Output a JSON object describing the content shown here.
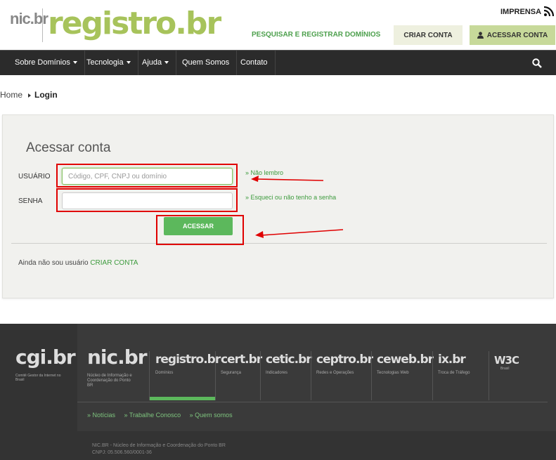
{
  "header": {
    "nic_logo": "nic.br",
    "registro_logo": "registro.br",
    "imprensa": "IMPRENSA",
    "search_register": "PESQUISAR E REGISTRAR DOMÍNIOS",
    "create_account": "CRIAR CONTA",
    "access_account": "ACESSAR CONTA"
  },
  "nav": {
    "items": [
      {
        "label": "Sobre Domínios",
        "dropdown": true
      },
      {
        "label": "Tecnologia",
        "dropdown": true
      },
      {
        "label": "Ajuda",
        "dropdown": true
      },
      {
        "label": "Quem Somos",
        "dropdown": false
      },
      {
        "label": "Contato",
        "dropdown": false
      }
    ]
  },
  "breadcrumb": {
    "home": "Home",
    "current": "Login"
  },
  "login": {
    "title": "Acessar conta",
    "user_label": "USUÁRIO",
    "user_placeholder": "Código, CPF, CNPJ ou domínio",
    "user_value": "",
    "forgot_user": "» Não lembro",
    "password_label": "SENHA",
    "password_value": "",
    "forgot_password": "» Esqueci ou não tenho a senha",
    "submit": "ACESSAR",
    "no_user_text": "Ainda não sou usuário",
    "create_account_link": "CRIAR CONTA"
  },
  "footer": {
    "cgi_logo": "cgi.br",
    "cgi_sub": "Comitê Gestor da Internet no Brasil",
    "nic_logo": "nic.br",
    "nic_sub": "Núcleo de Informação e Coordenação do Ponto BR",
    "sites": [
      {
        "logo": "registro.br",
        "sub": "Domínios"
      },
      {
        "logo": "cert.br",
        "sub": "Segurança"
      },
      {
        "logo": "cetic.br",
        "sub": "Indicadores"
      },
      {
        "logo": "ceptro.br",
        "sub": "Redes e Operações"
      },
      {
        "logo": "ceweb.br",
        "sub": "Tecnologias Web"
      },
      {
        "logo": "ix.br",
        "sub": "Troca de Tráfego"
      },
      {
        "logo": "W3C",
        "sub": "Brasil"
      }
    ],
    "links": [
      "» Notícias",
      "» Trabalhe Conosco",
      "» Quem somos"
    ],
    "copyright_line1": "NIC.BR - Núcleo de Informação e Coordenação do Ponto BR",
    "copyright_line2": "CNPJ: 05.506.560/0001-36"
  },
  "colors": {
    "brand_green": "#5cb85c",
    "nav_bg": "#2b2b2b",
    "annotation_red": "#e00000"
  }
}
